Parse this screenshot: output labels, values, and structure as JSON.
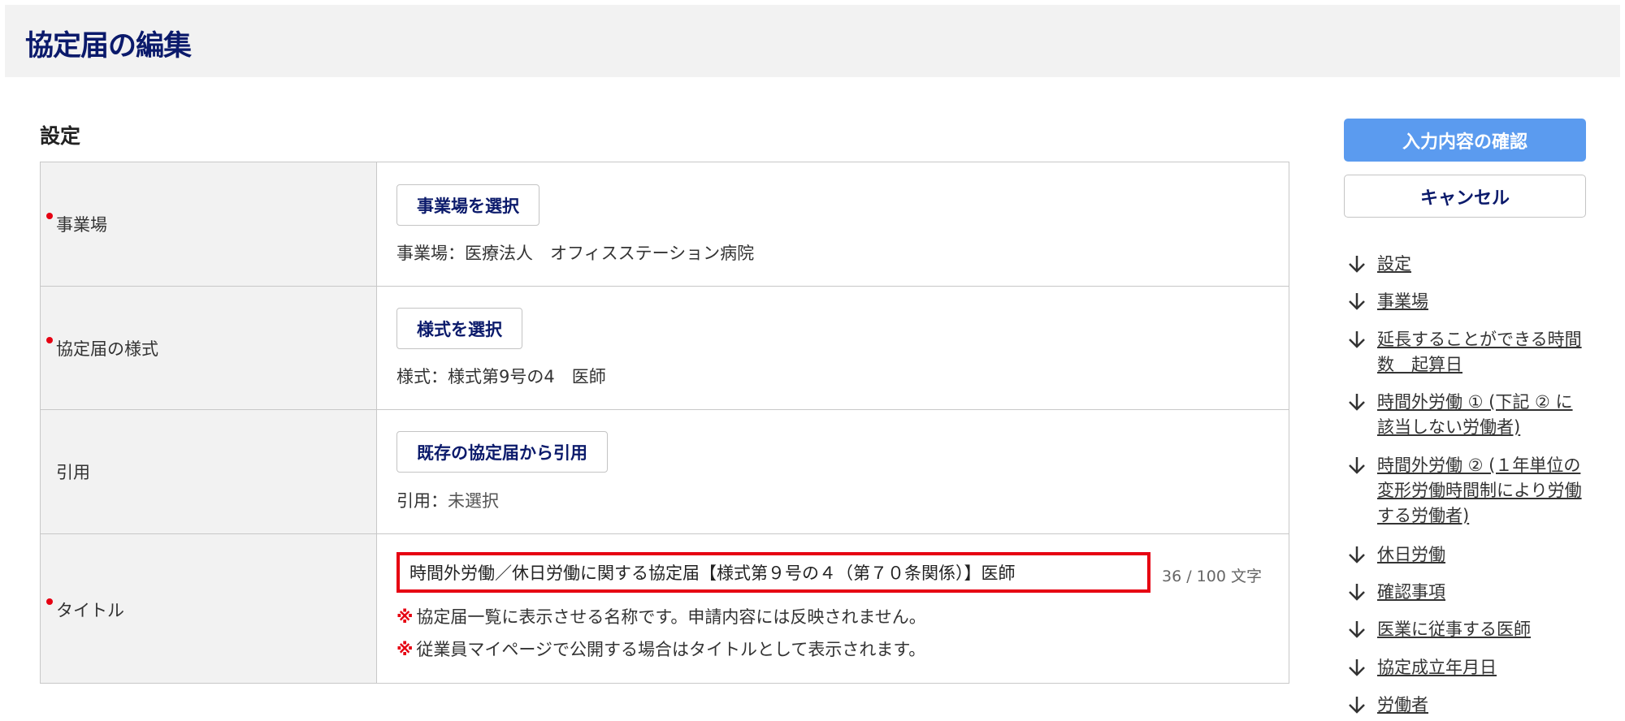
{
  "page": {
    "title": "協定届の編集"
  },
  "section": {
    "title": "設定"
  },
  "rows": {
    "workplace": {
      "label": "事業場",
      "button": "事業場を選択",
      "value_prefix": "事業場：",
      "value": "医療法人　オフィスステーション病院"
    },
    "form_type": {
      "label": "協定届の様式",
      "button": "様式を選択",
      "value_prefix": "様式：",
      "value": "様式第9号の4　医師"
    },
    "citation": {
      "label": "引用",
      "button": "既存の協定届から引用",
      "value_prefix": "引用：",
      "value": "未選択"
    },
    "title": {
      "label": "タイトル",
      "input_value": "時間外労働／休日労働に関する協定届【様式第９号の４（第７０条関係）】医師",
      "counter": "36 / 100 文字",
      "note_mark": "※",
      "note1": "協定届一覧に表示させる名称です。申請内容には反映されません。",
      "note2": "従業員マイページで公開する場合はタイトルとして表示されます。"
    }
  },
  "actions": {
    "confirm": "入力内容の確認",
    "cancel": "キャンセル"
  },
  "toc": [
    {
      "text": "設定",
      "icon": "arrow-down-icon"
    },
    {
      "text": "事業場",
      "icon": "arrow-down-icon"
    },
    {
      "text": "延長することができる時間数　起算日",
      "icon": "arrow-down-icon"
    },
    {
      "text": "時間外労働 ① (下記 ② に該当しない労働者)",
      "icon": "arrow-down-icon"
    },
    {
      "text": "時間外労働 ② (１年単位の変形労働時間制により労働する労働者)",
      "icon": "arrow-down-icon"
    },
    {
      "text": "休日労働",
      "icon": "arrow-down-icon"
    },
    {
      "text": "確認事項",
      "icon": "arrow-down-icon"
    },
    {
      "text": "医業に従事する医師",
      "icon": "arrow-down-icon"
    },
    {
      "text": "協定成立年月日",
      "icon": "arrow-down-icon"
    },
    {
      "text": "労働者",
      "icon": "arrow-down-icon"
    }
  ]
}
